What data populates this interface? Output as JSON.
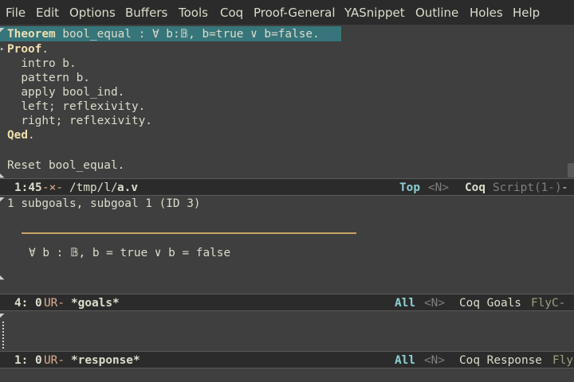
{
  "menubar": {
    "items": [
      {
        "label": "File"
      },
      {
        "label": "Edit"
      },
      {
        "label": "Options"
      },
      {
        "label": "Buffers"
      },
      {
        "label": "Tools"
      },
      {
        "label": "Coq"
      },
      {
        "label": "Proof-General"
      },
      {
        "label": "YASnippet"
      },
      {
        "label": "Outline"
      },
      {
        "label": "Holes"
      },
      {
        "label": "Help"
      }
    ]
  },
  "script": {
    "theorem_keyword": "Theorem",
    "theorem_rest": " bool_equal : ∀ b:𝔹, b=true ∨ b=false.",
    "proof_keyword": "Proof",
    "proof_dot": ".",
    "tactics": [
      "  intro b.",
      "  pattern b.",
      "  apply bool_ind.",
      "  left; reflexivity.",
      "  right; reflexivity."
    ],
    "qed_keyword": "Qed",
    "qed_dot": ".",
    "reset_line": "Reset bool_equal."
  },
  "modeline_script": {
    "position": "1:45",
    "status": " -×-",
    "path": "/tmp/l/",
    "filename": "a.v",
    "scroll": "Top",
    "flag": "<N>",
    "mode": "Coq",
    "extra": "Script(1-)",
    "tail": " -"
  },
  "goals": {
    "header": "1 subgoals, subgoal 1 (ID 3)",
    "goal": "∀ b : 𝔹, b = true ∨ b = false"
  },
  "modeline_goals": {
    "position": "4: 0",
    "status": " UR-",
    "buffer": "*goals*",
    "scroll": "All",
    "flag": "<N>",
    "mode": "Coq Goals",
    "extra": "FlyC-"
  },
  "modeline_response": {
    "position": "1: 0",
    "status": " UR-",
    "buffer": "*response*",
    "scroll": "All",
    "flag": "<N>",
    "mode": "Coq Response",
    "extra": "Fly"
  },
  "colors": {
    "background": "#3f3f3f",
    "modeline": "#2b2b2b",
    "theorem_highlight": "#36757a",
    "keyword": "#f0dfaf",
    "mode_blue": "#8cd0d3"
  }
}
